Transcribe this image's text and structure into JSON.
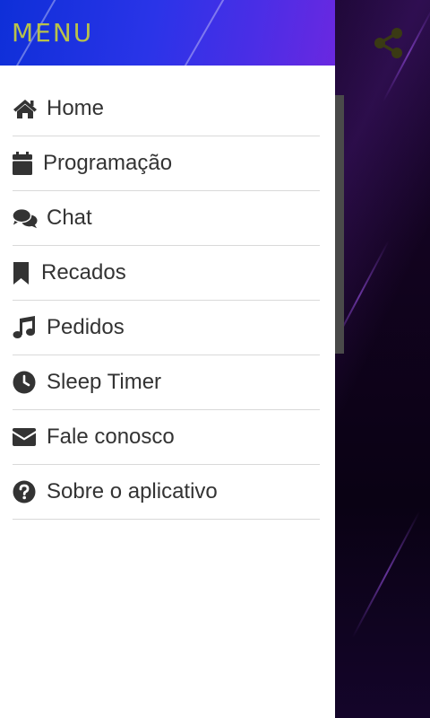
{
  "drawer": {
    "title": "MENU",
    "items": [
      {
        "label": "Home",
        "icon": "home-icon"
      },
      {
        "label": "Programação",
        "icon": "calendar-icon"
      },
      {
        "label": "Chat",
        "icon": "chat-icon"
      },
      {
        "label": "Recados",
        "icon": "bookmark-icon"
      },
      {
        "label": "Pedidos",
        "icon": "music-note-icon"
      },
      {
        "label": "Sleep Timer",
        "icon": "clock-icon"
      },
      {
        "label": "Fale conosco",
        "icon": "envelope-icon"
      },
      {
        "label": "Sobre o aplicativo",
        "icon": "question-circle-icon"
      }
    ]
  },
  "colors": {
    "header_gradient_start": "#0e2fd8",
    "header_gradient_end": "#6a28e0",
    "title_color": "#b9c24a",
    "icon_color": "#333333",
    "share_icon_color": "#3a3a14"
  },
  "app": {
    "share_icon": "share-icon"
  }
}
